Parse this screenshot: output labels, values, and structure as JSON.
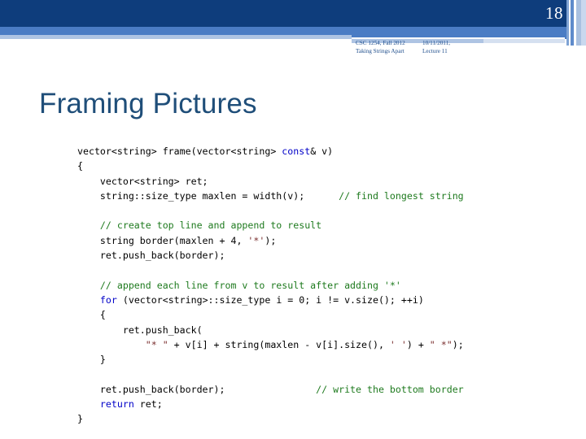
{
  "slide": {
    "number": "18",
    "title": "Framing Pictures"
  },
  "header": {
    "course": "CSC 1254, Fall 2012",
    "topic": "Taking Strings Apart",
    "date": "10/11/2011,",
    "lecture": "Lecture 11"
  },
  "code": {
    "language": "C++",
    "lines": [
      [
        {
          "t": "vector<string> frame(vector<string> ",
          "c": "pl"
        },
        {
          "t": "const",
          "c": "kw"
        },
        {
          "t": "& v)",
          "c": "pl"
        }
      ],
      [
        {
          "t": "{",
          "c": "pl"
        }
      ],
      [
        {
          "t": "    vector<string> ret;",
          "c": "pl"
        }
      ],
      [
        {
          "t": "    string::size_type maxlen = width(v);      ",
          "c": "pl"
        },
        {
          "t": "// find longest string",
          "c": "cmt"
        }
      ],
      [],
      [
        {
          "t": "    ",
          "c": "pl"
        },
        {
          "t": "// create top line and append to result",
          "c": "cmt"
        }
      ],
      [
        {
          "t": "    string border(maxlen + 4, ",
          "c": "pl"
        },
        {
          "t": "'*'",
          "c": "str"
        },
        {
          "t": ");",
          "c": "pl"
        }
      ],
      [
        {
          "t": "    ret.push_back(border);",
          "c": "pl"
        }
      ],
      [],
      [
        {
          "t": "    ",
          "c": "pl"
        },
        {
          "t": "// append each line from v to result after adding '*'",
          "c": "cmt"
        }
      ],
      [
        {
          "t": "    ",
          "c": "pl"
        },
        {
          "t": "for",
          "c": "kw"
        },
        {
          "t": " (vector<string>::size_type i = 0; i != v.size(); ++i)",
          "c": "pl"
        }
      ],
      [
        {
          "t": "    {",
          "c": "pl"
        }
      ],
      [
        {
          "t": "        ret.push_back(",
          "c": "pl"
        }
      ],
      [
        {
          "t": "            ",
          "c": "pl"
        },
        {
          "t": "\"* \"",
          "c": "str"
        },
        {
          "t": " + v[i] + string(maxlen - v[i].size(), ",
          "c": "pl"
        },
        {
          "t": "' '",
          "c": "str"
        },
        {
          "t": ") + ",
          "c": "pl"
        },
        {
          "t": "\" *\"",
          "c": "str"
        },
        {
          "t": ");",
          "c": "pl"
        }
      ],
      [
        {
          "t": "    }",
          "c": "pl"
        }
      ],
      [],
      [
        {
          "t": "    ret.push_back(border);                ",
          "c": "pl"
        },
        {
          "t": "// write the bottom border",
          "c": "cmt"
        }
      ],
      [
        {
          "t": "    ",
          "c": "pl"
        },
        {
          "t": "return",
          "c": "kw"
        },
        {
          "t": " ret;",
          "c": "pl"
        }
      ],
      [
        {
          "t": "}",
          "c": "pl"
        }
      ]
    ]
  },
  "colors": {
    "navy": "#0e3d7c",
    "medium_blue": "#4a7cc4",
    "light_blue": "#aec4e3",
    "title_blue": "#1f4e79",
    "keyword": "#0000c8",
    "comment": "#1e7a1e",
    "string": "#7a2f2f"
  }
}
